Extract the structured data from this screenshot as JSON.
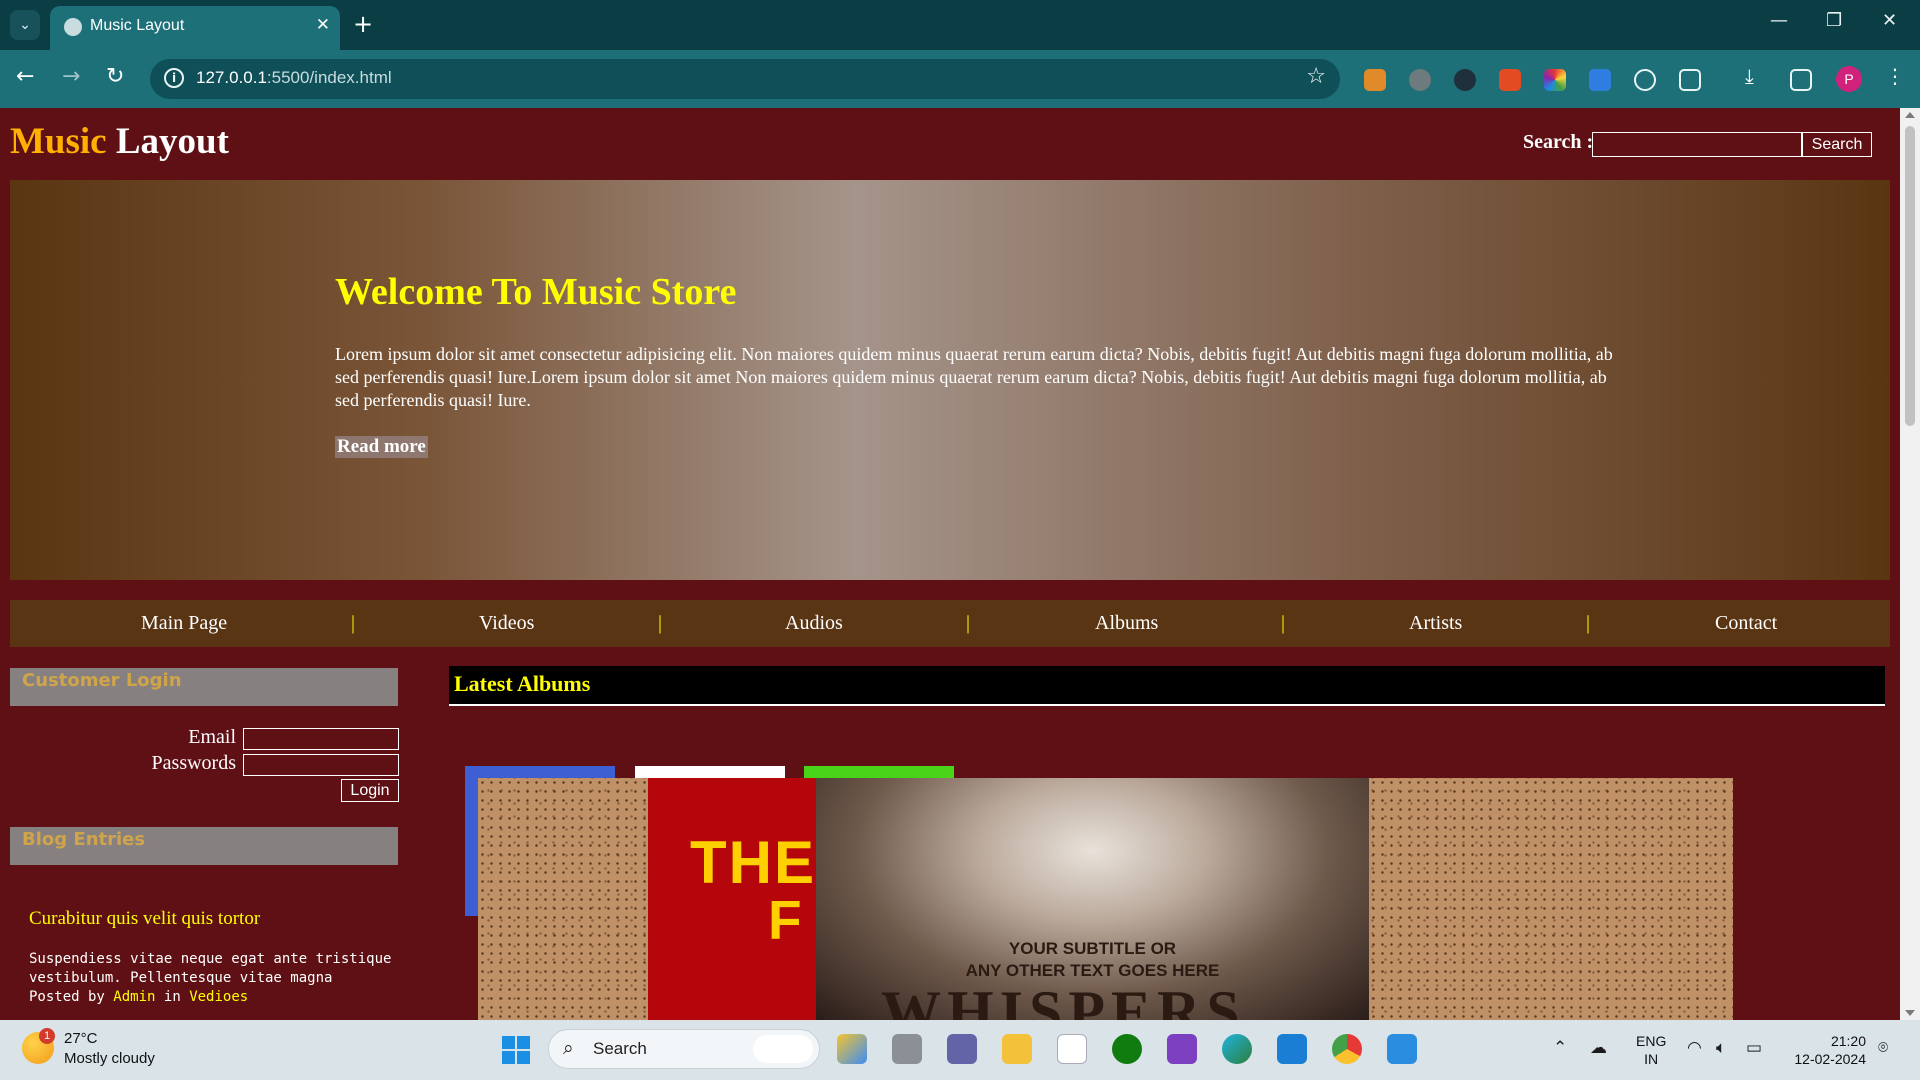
{
  "browser": {
    "tab_title": "Music Layout",
    "url_host": "127.0.0.1",
    "url_path": ":5500/index.html",
    "profile_initial": "P"
  },
  "site": {
    "logo_part1": "Music",
    "logo_part2": "Layout",
    "search_label": "Search :",
    "search_button": "Search",
    "search_value": ""
  },
  "hero": {
    "title": "Welcome To Music Store",
    "body": "Lorem ipsum dolor sit amet consectetur adipisicing elit. Non maiores quidem minus quaerat rerum earum dicta? Nobis, debitis fugit! Aut debitis magni fuga dolorum mollitia, ab sed perferendis quasi! Iure.Lorem ipsum dolor sit amet Non maiores quidem minus quaerat rerum earum dicta? Nobis, debitis fugit! Aut debitis magni fuga dolorum mollitia, ab sed perferendis quasi! Iure.",
    "read_more": "Read more"
  },
  "nav": {
    "items": [
      "Main Page",
      "Videos",
      "Audios",
      "Albums",
      "Artists",
      "Contact"
    ],
    "separator": "|"
  },
  "login": {
    "heading": "Customer Login",
    "email_label": "Email",
    "password_label": "Passwords",
    "email_value": "",
    "password_value": "",
    "button": "Login"
  },
  "blog": {
    "heading": "Blog Entries",
    "entry_title": "Curabitur quis velit quis tortor",
    "entry_text": "Suspendiess vitae neque egat ante tristique vestibulum. Pellentesque vitae magna",
    "posted_by": "Posted by",
    "author": "Admin",
    "in_word": "in",
    "category": "Vedioes"
  },
  "albums": {
    "heading": "Latest Albums",
    "frame_colors": [
      "#3e5fd3",
      "#ffffff",
      "#4ad419"
    ],
    "red_cover_text_line1": "THE",
    "red_cover_text_line2": "F",
    "whisper_subtitle_line1": "YOUR SUBTITLE OR",
    "whisper_subtitle_line2": "ANY OTHER TEXT GOES HERE",
    "whisper_title": "WHISPERS"
  },
  "taskbar": {
    "temperature": "27°C",
    "weather": "Mostly cloudy",
    "weather_badge": "1",
    "search_placeholder": "Search",
    "lang_line1": "ENG",
    "lang_line2": "IN",
    "time": "21:20",
    "date": "12-02-2024"
  },
  "icons": {
    "tab_menu": "chevron-down-icon",
    "close_tab": "close-icon",
    "new_tab": "plus-icon",
    "back": "arrow-left-icon",
    "forward": "arrow-right-icon",
    "reload": "reload-icon",
    "bookmark": "star-icon",
    "downloads": "download-icon",
    "menu": "kebab-menu-icon"
  }
}
